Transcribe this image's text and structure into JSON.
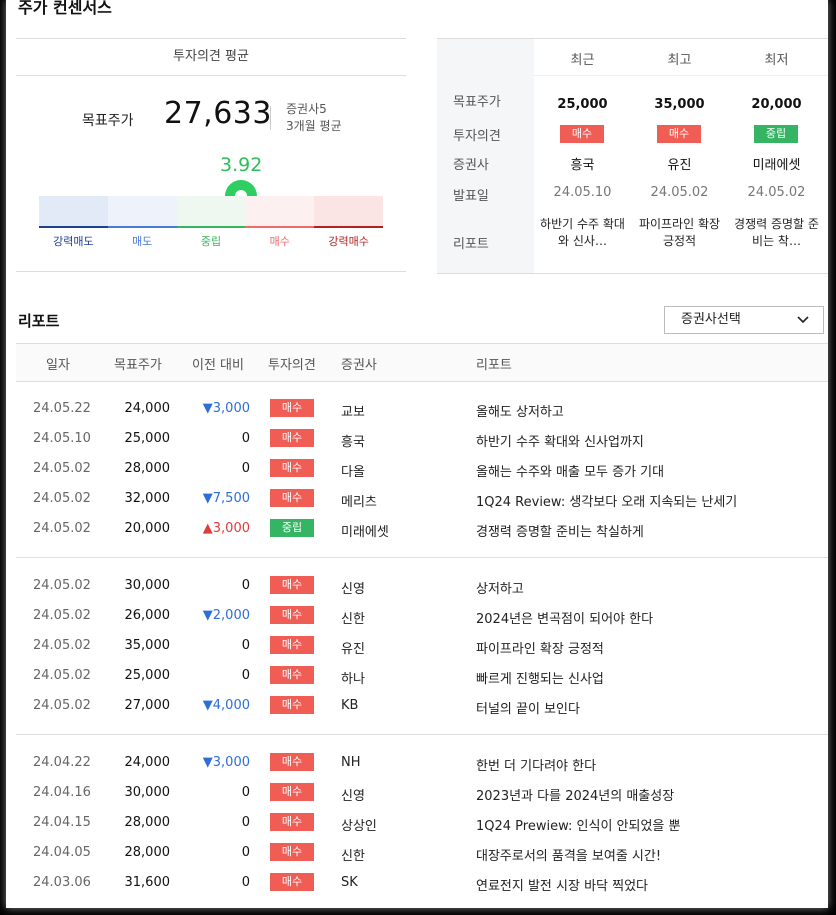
{
  "section_title": "주가 컨센서스",
  "summary": {
    "header": "투자의견 평균",
    "target_label": "목표주가",
    "target_value": "27,633",
    "brokers_count": "증권사5",
    "period": "3개월 평균",
    "score": "3.92",
    "gauge_labels": [
      "강력매도",
      "매도",
      "중립",
      "매수",
      "강력매수"
    ]
  },
  "compare": {
    "row_labels": [
      "목표주가",
      "투자의견",
      "증권사",
      "발표일",
      "리포트"
    ],
    "columns": [
      {
        "header": "최근",
        "price": "25,000",
        "opinion": "매수",
        "opinion_type": "buy",
        "broker": "흥국",
        "date": "24.05.10",
        "report": "하반기 수주 확대와 신사…"
      },
      {
        "header": "최고",
        "price": "35,000",
        "opinion": "매수",
        "opinion_type": "buy",
        "broker": "유진",
        "date": "24.05.02",
        "report": "파이프라인 확장 긍정적"
      },
      {
        "header": "최저",
        "price": "20,000",
        "opinion": "중립",
        "opinion_type": "neutral",
        "broker": "미래에셋",
        "date": "24.05.02",
        "report": "경쟁력 증명할 준비는 착…"
      }
    ]
  },
  "reports": {
    "title": "리포트",
    "select_label": "증권사선택",
    "columns": [
      "일자",
      "목표주가",
      "이전 대비",
      "투자의견",
      "증권사",
      "리포트"
    ],
    "groups": [
      [
        {
          "date": "24.05.22",
          "price": "24,000",
          "diff": "▼3,000",
          "dir": "down",
          "op": "매수",
          "optype": "buy",
          "broker": "교보",
          "report": "올해도 상저하고"
        },
        {
          "date": "24.05.10",
          "price": "25,000",
          "diff": "0",
          "dir": "none",
          "op": "매수",
          "optype": "buy",
          "broker": "흥국",
          "report": "하반기 수주 확대와 신사업까지"
        },
        {
          "date": "24.05.02",
          "price": "28,000",
          "diff": "0",
          "dir": "none",
          "op": "매수",
          "optype": "buy",
          "broker": "다올",
          "report": "올해는 수주와 매출 모두 증가 기대"
        },
        {
          "date": "24.05.02",
          "price": "32,000",
          "diff": "▼7,500",
          "dir": "down",
          "op": "매수",
          "optype": "buy",
          "broker": "메리츠",
          "report": "1Q24 Review: 생각보다 오래 지속되는 난세기"
        },
        {
          "date": "24.05.02",
          "price": "20,000",
          "diff": "▲3,000",
          "dir": "up",
          "op": "중립",
          "optype": "neutral",
          "broker": "미래에셋",
          "report": "경쟁력 증명할 준비는 착실하게"
        }
      ],
      [
        {
          "date": "24.05.02",
          "price": "30,000",
          "diff": "0",
          "dir": "none",
          "op": "매수",
          "optype": "buy",
          "broker": "신영",
          "report": "상저하고"
        },
        {
          "date": "24.05.02",
          "price": "26,000",
          "diff": "▼2,000",
          "dir": "down",
          "op": "매수",
          "optype": "buy",
          "broker": "신한",
          "report": "2024년은 변곡점이 되어야 한다"
        },
        {
          "date": "24.05.02",
          "price": "35,000",
          "diff": "0",
          "dir": "none",
          "op": "매수",
          "optype": "buy",
          "broker": "유진",
          "report": "파이프라인 확장 긍정적"
        },
        {
          "date": "24.05.02",
          "price": "25,000",
          "diff": "0",
          "dir": "none",
          "op": "매수",
          "optype": "buy",
          "broker": "하나",
          "report": "빠르게 진행되는 신사업"
        },
        {
          "date": "24.05.02",
          "price": "27,000",
          "diff": "▼4,000",
          "dir": "down",
          "op": "매수",
          "optype": "buy",
          "broker": "KB",
          "report": "터널의 끝이 보인다"
        }
      ],
      [
        {
          "date": "24.04.22",
          "price": "24,000",
          "diff": "▼3,000",
          "dir": "down",
          "op": "매수",
          "optype": "buy",
          "broker": "NH",
          "report": "한번 더 기다려야 한다"
        },
        {
          "date": "24.04.16",
          "price": "30,000",
          "diff": "0",
          "dir": "none",
          "op": "매수",
          "optype": "buy",
          "broker": "신영",
          "report": "2023년과 다를 2024년의 매출성장"
        },
        {
          "date": "24.04.15",
          "price": "28,000",
          "diff": "0",
          "dir": "none",
          "op": "매수",
          "optype": "buy",
          "broker": "상상인",
          "report": "1Q24 Prewiew: 인식이 안되었을 뿐"
        },
        {
          "date": "24.04.05",
          "price": "28,000",
          "diff": "0",
          "dir": "none",
          "op": "매수",
          "optype": "buy",
          "broker": "신한",
          "report": "대장주로서의 품격을 보여줄 시간!"
        },
        {
          "date": "24.03.06",
          "price": "31,600",
          "diff": "0",
          "dir": "none",
          "op": "매수",
          "optype": "buy",
          "broker": "SK",
          "report": "연료전지 발전 시장 바닥 찍었다"
        }
      ]
    ]
  },
  "colors": {
    "buy": "#ef5d54",
    "neutral": "#35b564",
    "down": "#2d6fd6",
    "up": "#e23b3b",
    "score": "#2ebd59"
  }
}
